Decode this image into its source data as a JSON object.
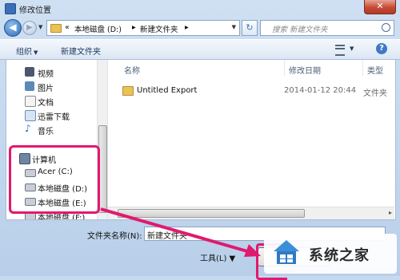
{
  "window": {
    "title": "修改位置",
    "close_glyph": "✕"
  },
  "nav": {
    "back_glyph": "◀",
    "forward_glyph": "▶",
    "address_prefix": "«",
    "address_crumbs": [
      "本地磁盘 (D:)",
      "新建文件夹"
    ],
    "address_sep": "▸",
    "refresh_glyph": "↻",
    "search_placeholder": "搜索 新建文件夹"
  },
  "toolbar": {
    "organize": "组织",
    "new_folder": "新建文件夹",
    "help": "?"
  },
  "sidebar": {
    "items": [
      {
        "label": "视频",
        "icon": "video-icon"
      },
      {
        "label": "图片",
        "icon": "picture-icon"
      },
      {
        "label": "文档",
        "icon": "document-icon"
      },
      {
        "label": "迅雷下载",
        "icon": "download-icon"
      },
      {
        "label": "音乐",
        "icon": "music-icon"
      },
      {
        "label": "计算机",
        "icon": "computer-icon"
      },
      {
        "label": "Acer (C:)",
        "icon": "drive-icon"
      },
      {
        "label": "本地磁盘 (D:)",
        "icon": "drive-icon"
      },
      {
        "label": "本地磁盘 (E:)",
        "icon": "drive-icon"
      },
      {
        "label": "本地磁盘 (F:)",
        "icon": "drive-icon"
      }
    ]
  },
  "files": {
    "columns": [
      "名称",
      "修改日期",
      "类型"
    ],
    "rows": [
      {
        "name": "Untitled Export",
        "date": "2014-01-12 20:44",
        "type": "文件夹"
      }
    ]
  },
  "bottom": {
    "filename_label": "文件夹名称(N):",
    "filename_value": "新建文件夹",
    "tools_label": "工具(L)"
  },
  "watermark": {
    "text": "系统之家"
  },
  "colors": {
    "highlight": "#e01a6f",
    "folder": "#e9c35a"
  }
}
